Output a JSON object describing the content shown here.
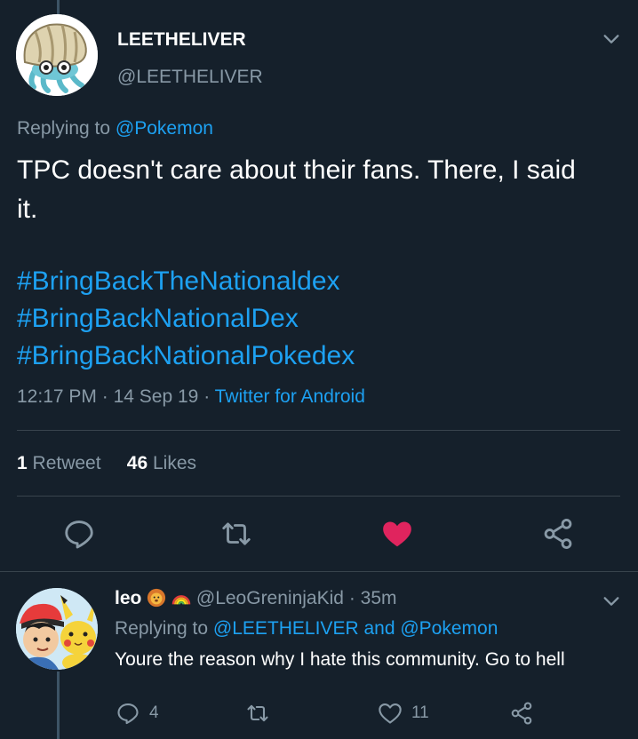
{
  "tweet": {
    "author_name": "LEETHELIVER",
    "author_handle": "@LEETHELIVER",
    "replying_prefix": "Replying to",
    "replying_to": "@Pokemon",
    "text": "TPC doesn't care about their fans. There, I said it.",
    "hashtags": [
      "#BringBackTheNationaldex",
      "#BringBackNationalDex",
      "#BringBackNationalPokedex"
    ],
    "time": "12:17 PM",
    "date": "14 Sep 19",
    "source": "Twitter for Android",
    "separator": "·",
    "retweets_count": "1",
    "retweets_label": "Retweet",
    "likes_count": "46",
    "likes_label": "Likes",
    "liked": true
  },
  "reply": {
    "author_name": "leo",
    "author_handle": "@LeoGreninjaKid",
    "age": "35m",
    "replying_prefix": "Replying to",
    "replying_to_1": "@LEETHELIVER",
    "replying_and": "and",
    "replying_to_2": "@Pokemon",
    "text": "Youre the reason why I hate this community. Go to hell",
    "reply_count": "4",
    "like_count": "11"
  },
  "colors": {
    "background": "#15202b",
    "accent": "#1da1f2",
    "muted": "#8899a6",
    "like": "#e0245e",
    "divider": "#38444d"
  },
  "icons": {
    "menu": "chevron-down-icon",
    "reply": "reply-icon",
    "retweet": "retweet-icon",
    "like": "heart-icon",
    "share": "share-icon"
  }
}
